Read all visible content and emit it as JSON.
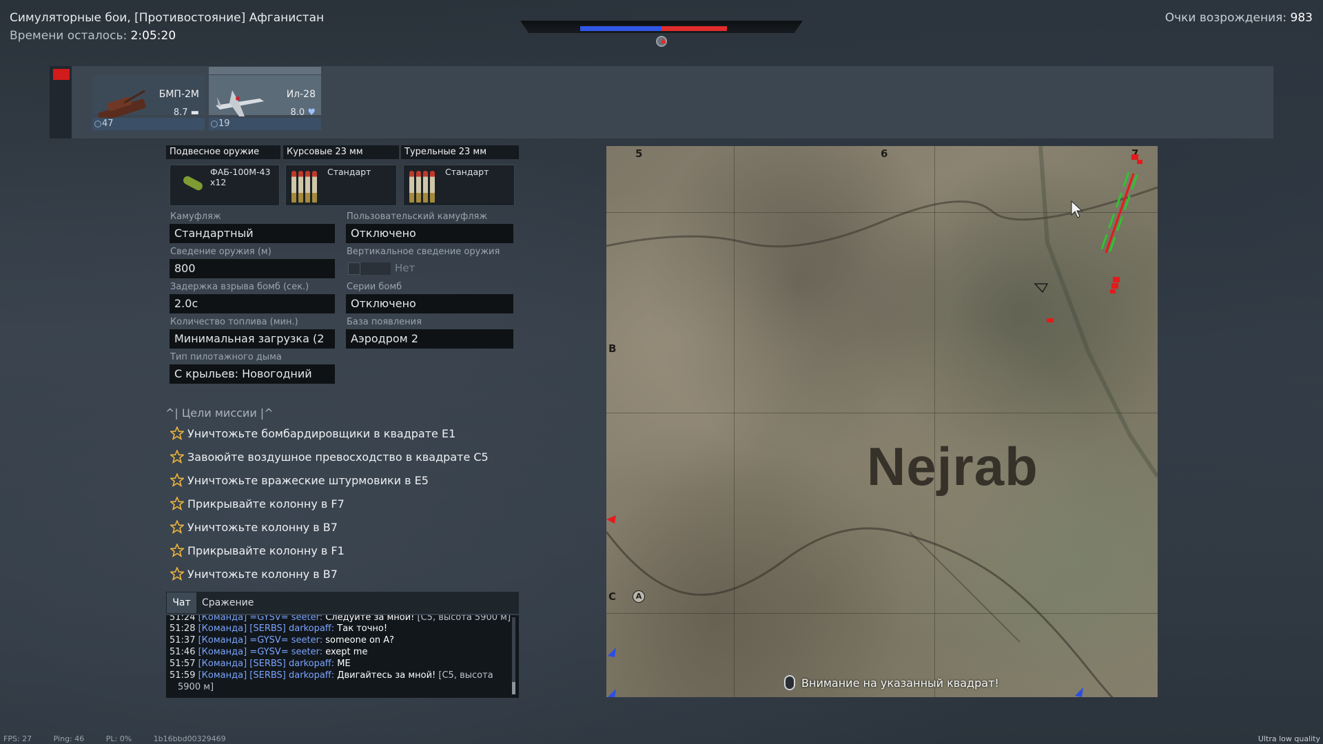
{
  "header": {
    "mission_title": "Симуляторные бои, [Противостояние] Афганистан",
    "time_label": "Времени осталось:",
    "time_value": "2:05:20",
    "respawn_label": "Очки возрождения:",
    "respawn_value": "983"
  },
  "score": {
    "team_blue_color": "#3057e6",
    "team_red_color": "#e02c2c"
  },
  "vehicles": [
    {
      "name": "БМП-2М",
      "br": "8.7",
      "count": "47",
      "selected": false
    },
    {
      "name": "Ил-28",
      "br": "8.0",
      "count": "19",
      "selected": true
    }
  ],
  "weapons": {
    "headers": [
      "Подвесное оружие",
      "Курсовые 23 мм",
      "Турельные 23 мм"
    ],
    "slots": [
      {
        "line1": "ФАБ-100М-43",
        "line2": "x12"
      },
      {
        "line1": "Стандарт",
        "line2": ""
      },
      {
        "line1": "Стандарт",
        "line2": ""
      }
    ]
  },
  "settings": {
    "camo_label": "Камуфляж",
    "camo_value": "Стандартный",
    "user_camo_label": "Пользовательский камуфляж",
    "user_camo_value": "Отключено",
    "convergence_label": "Сведение оружия (м)",
    "convergence_value": "800",
    "vconv_label": "Вертикальное сведение оружия",
    "vconv_value": "Нет",
    "bomb_delay_label": "Задержка взрыва бомб (сек.)",
    "bomb_delay_value": "2.0с",
    "bomb_series_label": "Серии бомб",
    "bomb_series_value": "Отключено",
    "fuel_label": "Количество топлива (мин.)",
    "fuel_value": "Минимальная загрузка (2",
    "spawn_label": "База появления",
    "spawn_value": "Аэродром 2",
    "smoke_label": "Тип пилотажного дыма",
    "smoke_value": "С крыльев: Новогодний"
  },
  "objectives": {
    "header": "^| Цели миссии |^",
    "items": [
      "Уничтожьте бомбардировщики в квадрате  E1",
      "Завоюйте воздушное превосходство в квадрате  C5",
      "Уничтожьте вражеские штурмовики в  E5",
      "Прикрывайте колонну в  F7",
      "Уничтожьте колонну в  B7",
      "Прикрывайте колонну в  F1",
      "Уничтожьте колонну в  B7"
    ]
  },
  "chat": {
    "tabs": [
      "Чат",
      "Сражение"
    ],
    "lines": [
      {
        "time": "51:24",
        "prefix": "[Команда] =GYSV= seeter:",
        "msg": "Следуйте за мной!",
        "extra": "[C5, высота 5900 м]"
      },
      {
        "time": "51:28",
        "prefix": "[Команда] [SERBS] darkopaff:",
        "msg": "Так точно!",
        "extra": ""
      },
      {
        "time": "51:37",
        "prefix": "[Команда] =GYSV= seeter:",
        "msg": "someone on A?",
        "extra": ""
      },
      {
        "time": "51:46",
        "prefix": "[Команда] =GYSV= seeter:",
        "msg": "exept me",
        "extra": ""
      },
      {
        "time": "51:57",
        "prefix": "[Команда] [SERBS] darkopaff:",
        "msg": "ME",
        "extra": ""
      },
      {
        "time": "51:59",
        "prefix": "[Команда] [SERBS] darkopaff:",
        "msg": "Двигайтесь за мной!",
        "extra": "[C5, высота"
      },
      {
        "time": "",
        "prefix": "",
        "msg": "",
        "extra": "5900 м]"
      }
    ]
  },
  "map": {
    "name": "Nejrab",
    "col_labels": [
      "5",
      "6",
      "7"
    ],
    "row_labels": [
      "B",
      "C"
    ],
    "zone_label": "A",
    "hint": "Внимание на указанный квадрат!"
  },
  "footer": {
    "fps": "FPS: 27",
    "ping": "Ping: 46",
    "pl": "PL: 0%",
    "session": "1b16bbd00329469",
    "quality": "Ultra low quality"
  }
}
